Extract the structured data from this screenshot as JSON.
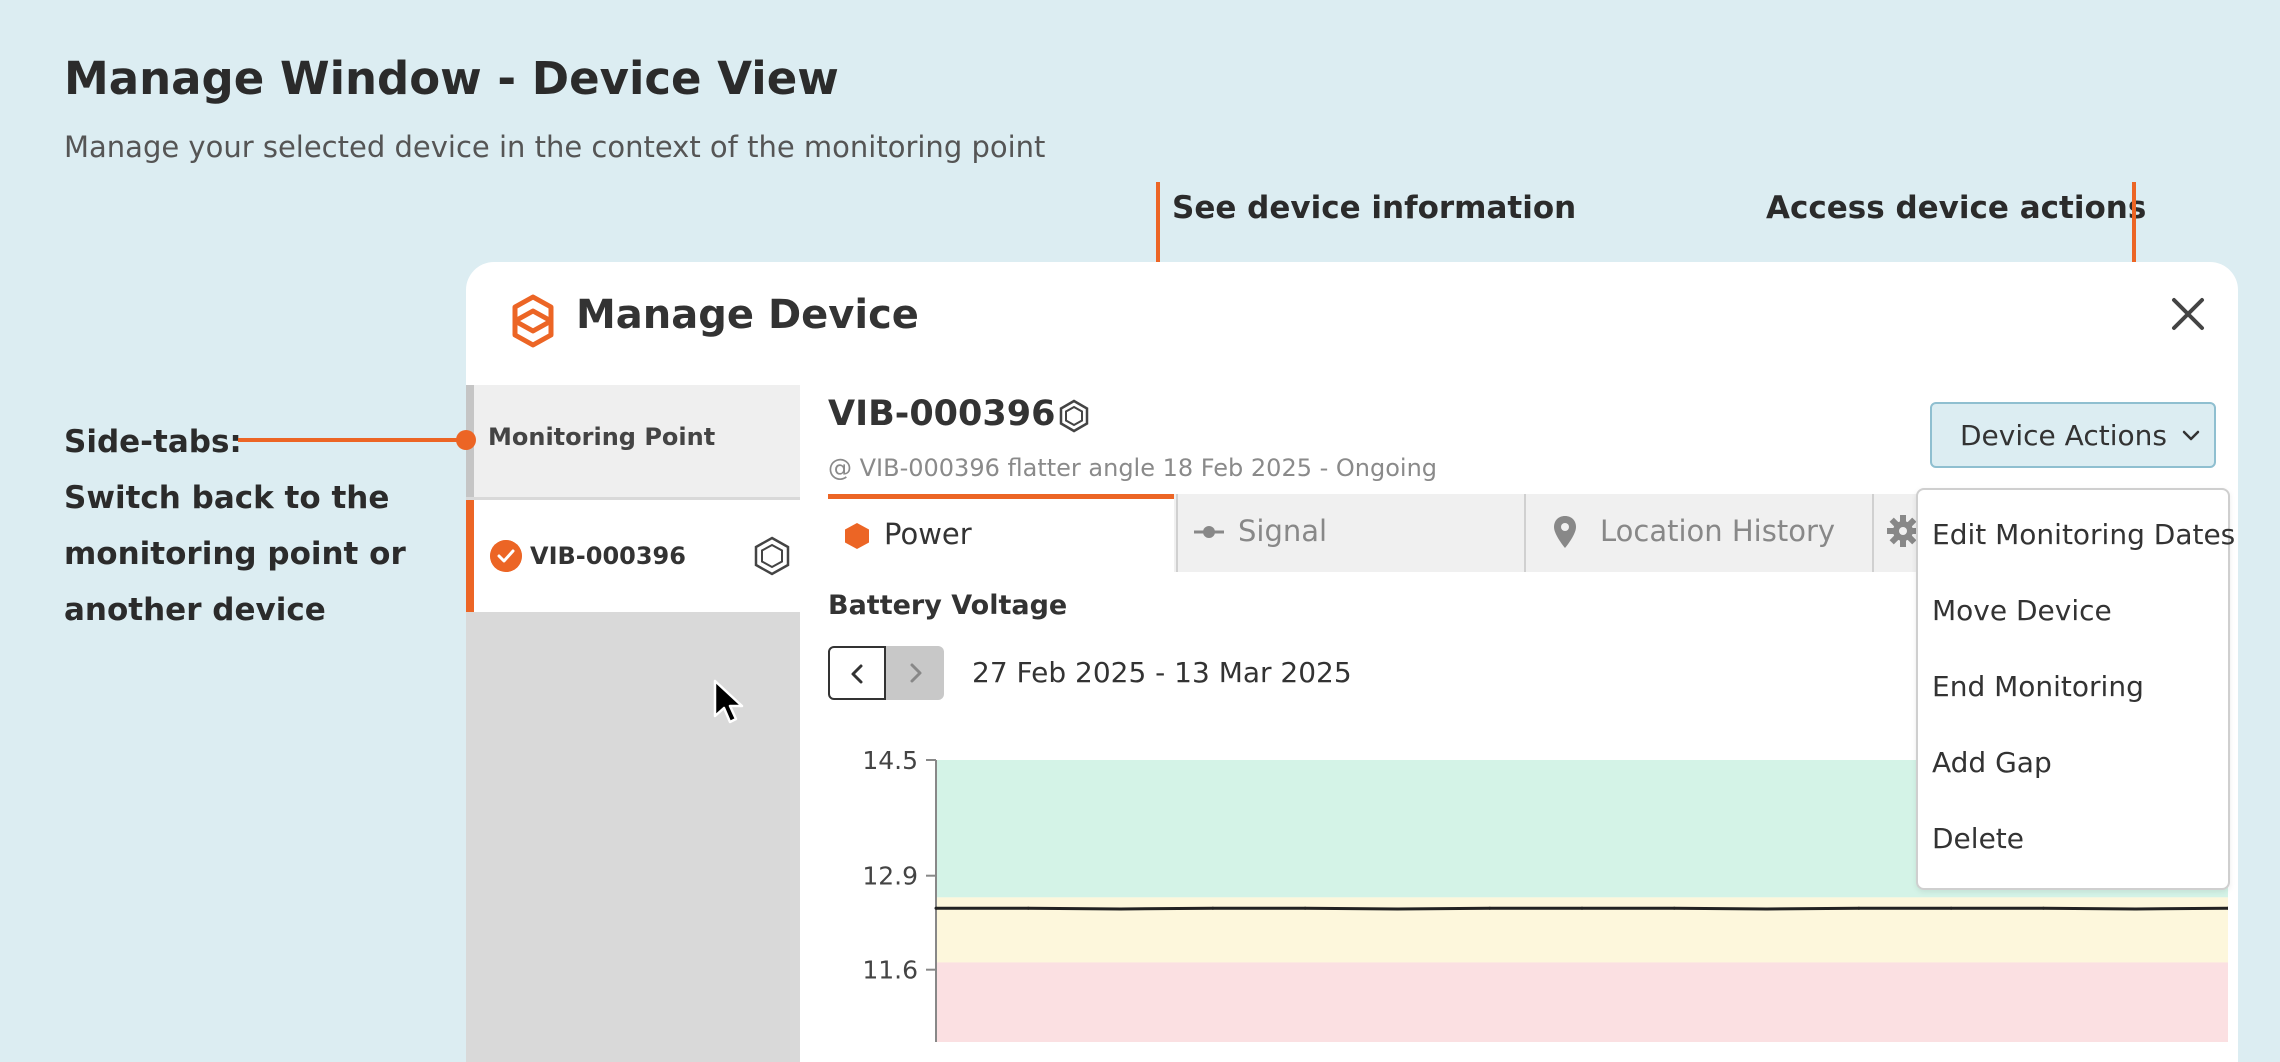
{
  "header": {
    "title": "Manage Window - Device View",
    "subtitle": "Manage your selected device in the context of the monitoring point"
  },
  "callouts": {
    "device_info": "See device information",
    "device_actions": "Access device actions",
    "side_tabs_lines": [
      "Side-tabs:",
      "Switch back to the",
      "monitoring point or",
      "another device"
    ]
  },
  "window": {
    "title": "Manage Device",
    "side_tabs": {
      "monitoring_point": "Monitoring Point",
      "device": "VIB-000396"
    },
    "device": {
      "name": "VIB-000396",
      "subtitle": "@ VIB-000396 flatter angle 18 Feb 2025 - Ongoing"
    },
    "actions_button": "Device Actions",
    "tabs": [
      {
        "label": "Power"
      },
      {
        "label": "Signal"
      },
      {
        "label": "Location History"
      }
    ],
    "chart_title": "Battery Voltage",
    "date_range": "27 Feb 2025 - 13 Mar 2025",
    "dropdown": [
      "Edit Monitoring Dates",
      "Move Device",
      "End Monitoring",
      "Add Gap",
      "Delete"
    ]
  },
  "colors": {
    "accent": "#ec6525",
    "band_good": "#d4f3e7",
    "band_warn": "#fdf7dc",
    "band_bad": "#fbe0e2"
  },
  "chart_data": {
    "type": "line",
    "title": "Battery Voltage",
    "y_ticks": [
      "14.5",
      "12.9",
      "11.6"
    ],
    "ylim": [
      10.6,
      14.5
    ],
    "bands": [
      {
        "from": 12.6,
        "to": 14.5,
        "color": "#d4f3e7"
      },
      {
        "from": 11.7,
        "to": 12.6,
        "color": "#fdf7dc"
      },
      {
        "from": 10.6,
        "to": 11.7,
        "color": "#fbe0e2"
      }
    ],
    "series": [
      {
        "values": [
          12.45,
          12.45,
          12.44,
          12.45,
          12.45,
          12.44,
          12.45,
          12.45,
          12.45,
          12.44,
          12.45,
          12.45,
          12.45,
          12.44,
          12.45
        ]
      }
    ]
  }
}
